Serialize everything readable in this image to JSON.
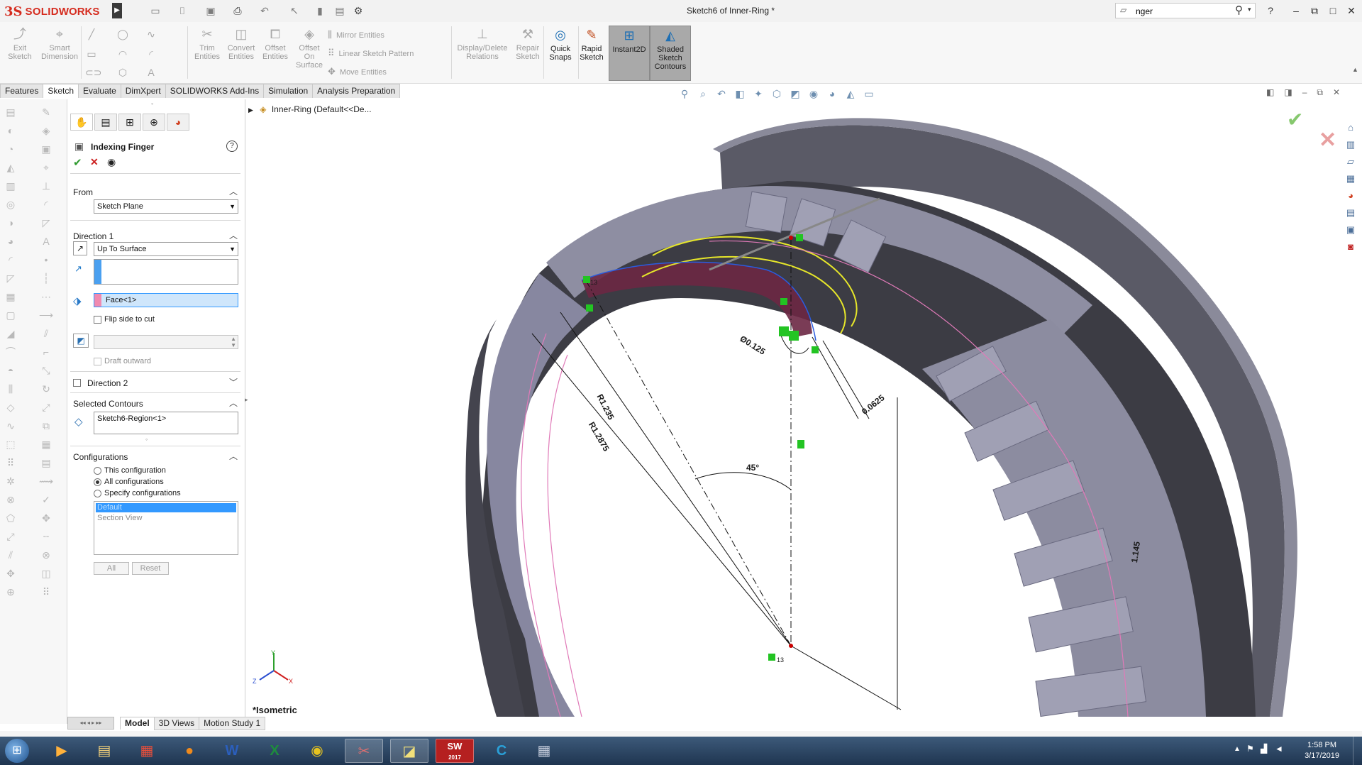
{
  "window": {
    "title": "Sketch6 of Inner-Ring *",
    "app_brand_ds": "3S",
    "app_brand_solid": "SOLID",
    "app_brand_works": "WORKS",
    "search_value": "nger",
    "help_icon": "?"
  },
  "ribbon": {
    "exit_sketch": [
      "Exit",
      "Sketch"
    ],
    "smart_dimension": [
      "Smart",
      "Dimension"
    ],
    "trim_entities": [
      "Trim",
      "Entities"
    ],
    "convert_entities": [
      "Convert",
      "Entities"
    ],
    "offset_entities": [
      "Offset",
      "Entities"
    ],
    "offset_on_surface": [
      "Offset",
      "On",
      "Surface"
    ],
    "mirror_entities": "Mirror Entities",
    "linear_sketch_pattern": "Linear Sketch Pattern",
    "move_entities": "Move Entities",
    "display_delete_relations": [
      "Display/Delete",
      "Relations"
    ],
    "repair_sketch": [
      "Repair",
      "Sketch"
    ],
    "quick_snaps": [
      "Quick",
      "Snaps"
    ],
    "rapid_sketch": [
      "Rapid",
      "Sketch"
    ],
    "instant2d": "Instant2D",
    "shaded_sketch_contours": [
      "Shaded",
      "Sketch",
      "Contours"
    ]
  },
  "tabs": [
    "Features",
    "Sketch",
    "Evaluate",
    "DimXpert",
    "SOLIDWORKS Add-Ins",
    "Simulation",
    "Analysis Preparation"
  ],
  "active_tab": "Sketch",
  "property_manager": {
    "title": "Indexing Finger",
    "from": {
      "header": "From",
      "value": "Sketch Plane"
    },
    "direction1": {
      "header": "Direction 1",
      "end_condition": "Up To Surface",
      "face_value": "Face<1>",
      "flip_label": "Flip side to cut",
      "draft_label": "Draft outward"
    },
    "direction2": {
      "header": "Direction 2"
    },
    "selected_contours": {
      "header": "Selected Contours",
      "value": "Sketch6-Region<1>"
    },
    "configurations": {
      "header": "Configurations",
      "options": [
        "This configuration",
        "All configurations",
        "Specify configurations"
      ],
      "selected_option": "All configurations",
      "list": [
        "Default",
        "Section View"
      ],
      "all_button": "All",
      "reset_button": "Reset"
    }
  },
  "feature_tree_flyout": "Inner-Ring  (Default<<De...",
  "viewport": {
    "view_label": "*Isometric",
    "dimensions": {
      "r1": "R1.235",
      "r2": "R1.2875",
      "dia": "Ø0.125",
      "offset": "0.0625",
      "angle": "45°",
      "height": "1.145"
    },
    "point_tags": [
      "13",
      "13"
    ],
    "triad": {
      "x": "X",
      "y": "Y",
      "z": "Z"
    }
  },
  "bottom_tabs": [
    "Model",
    "3D Views",
    "Motion Study 1"
  ],
  "active_bottom_tab": "Model",
  "taskbar": {
    "time": "1:58 PM",
    "date": "3/17/2019",
    "solidworks_badge": "SW",
    "solidworks_year": "2017"
  },
  "colors": {
    "brand_red": "#d52b1e",
    "part_gray": "#7f7f92",
    "part_dark": "#404048",
    "sketch_yellow": "#e6e62a",
    "highlight_maroon": "#6b2744",
    "selection_blue": "#3399ff"
  }
}
